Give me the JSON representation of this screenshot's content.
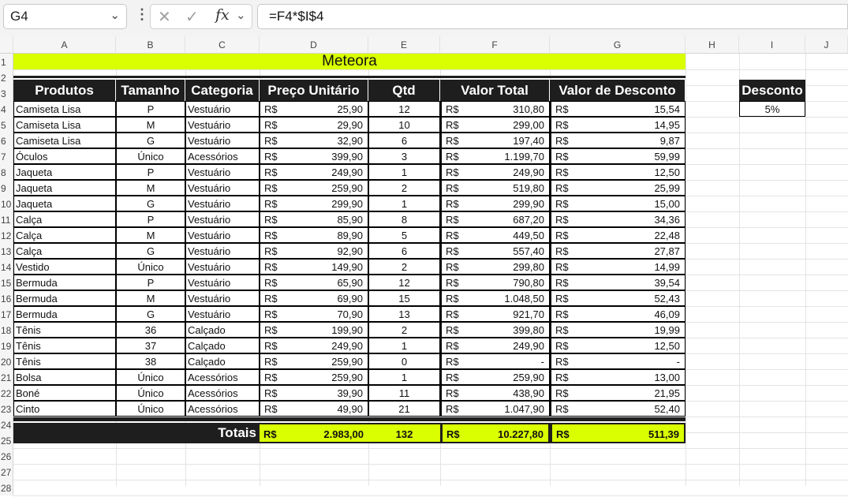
{
  "formula_bar": {
    "name_box": "G4",
    "formula": "=F4*$I$4",
    "icons": [
      "cancel-icon",
      "check-icon",
      "function-icon"
    ]
  },
  "columns": [
    "A",
    "B",
    "C",
    "D",
    "E",
    "F",
    "G",
    "H",
    "I",
    "J"
  ],
  "rows": [
    "1",
    "2",
    "3",
    "4",
    "5",
    "6",
    "7",
    "8",
    "9",
    "10",
    "11",
    "12",
    "13",
    "14",
    "15",
    "16",
    "17",
    "18",
    "19",
    "20",
    "21",
    "22",
    "23",
    "24",
    "25",
    "26",
    "27",
    "28"
  ],
  "sheet": {
    "title": "Meteora",
    "headers": [
      "Produtos",
      "Tamanho",
      "Categoria",
      "Preço Unitário",
      "Qtd",
      "Valor Total",
      "Valor de Desconto"
    ],
    "currency": "R$",
    "rows": [
      {
        "produto": "Camiseta Lisa",
        "tamanho": "P",
        "categoria": "Vestuário",
        "preco": "25,90",
        "qtd": "12",
        "total": "310,80",
        "desconto": "15,54"
      },
      {
        "produto": "Camiseta Lisa",
        "tamanho": "M",
        "categoria": "Vestuário",
        "preco": "29,90",
        "qtd": "10",
        "total": "299,00",
        "desconto": "14,95"
      },
      {
        "produto": "Camiseta Lisa",
        "tamanho": "G",
        "categoria": "Vestuário",
        "preco": "32,90",
        "qtd": "6",
        "total": "197,40",
        "desconto": "9,87"
      },
      {
        "produto": "Óculos",
        "tamanho": "Único",
        "categoria": "Acessórios",
        "preco": "399,90",
        "qtd": "3",
        "total": "1.199,70",
        "desconto": "59,99"
      },
      {
        "produto": "Jaqueta",
        "tamanho": "P",
        "categoria": "Vestuário",
        "preco": "249,90",
        "qtd": "1",
        "total": "249,90",
        "desconto": "12,50"
      },
      {
        "produto": "Jaqueta",
        "tamanho": "M",
        "categoria": "Vestuário",
        "preco": "259,90",
        "qtd": "2",
        "total": "519,80",
        "desconto": "25,99"
      },
      {
        "produto": "Jaqueta",
        "tamanho": "G",
        "categoria": "Vestuário",
        "preco": "299,90",
        "qtd": "1",
        "total": "299,90",
        "desconto": "15,00"
      },
      {
        "produto": "Calça",
        "tamanho": "P",
        "categoria": "Vestuário",
        "preco": "85,90",
        "qtd": "8",
        "total": "687,20",
        "desconto": "34,36"
      },
      {
        "produto": "Calça",
        "tamanho": "M",
        "categoria": "Vestuário",
        "preco": "89,90",
        "qtd": "5",
        "total": "449,50",
        "desconto": "22,48"
      },
      {
        "produto": "Calça",
        "tamanho": "G",
        "categoria": "Vestuário",
        "preco": "92,90",
        "qtd": "6",
        "total": "557,40",
        "desconto": "27,87"
      },
      {
        "produto": "Vestido",
        "tamanho": "Único",
        "categoria": "Vestuário",
        "preco": "149,90",
        "qtd": "2",
        "total": "299,80",
        "desconto": "14,99"
      },
      {
        "produto": "Bermuda",
        "tamanho": "P",
        "categoria": "Vestuário",
        "preco": "65,90",
        "qtd": "12",
        "total": "790,80",
        "desconto": "39,54"
      },
      {
        "produto": "Bermuda",
        "tamanho": "M",
        "categoria": "Vestuário",
        "preco": "69,90",
        "qtd": "15",
        "total": "1.048,50",
        "desconto": "52,43"
      },
      {
        "produto": "Bermuda",
        "tamanho": "G",
        "categoria": "Vestuário",
        "preco": "70,90",
        "qtd": "13",
        "total": "921,70",
        "desconto": "46,09"
      },
      {
        "produto": "Tênis",
        "tamanho": "36",
        "categoria": "Calçado",
        "preco": "199,90",
        "qtd": "2",
        "total": "399,80",
        "desconto": "19,99"
      },
      {
        "produto": "Tênis",
        "tamanho": "37",
        "categoria": "Calçado",
        "preco": "249,90",
        "qtd": "1",
        "total": "249,90",
        "desconto": "12,50"
      },
      {
        "produto": "Tênis",
        "tamanho": "38",
        "categoria": "Calçado",
        "preco": "259,90",
        "qtd": "0",
        "total": "-",
        "desconto": "-"
      },
      {
        "produto": "Bolsa",
        "tamanho": "Único",
        "categoria": "Acessórios",
        "preco": "259,90",
        "qtd": "1",
        "total": "259,90",
        "desconto": "13,00"
      },
      {
        "produto": "Boné",
        "tamanho": "Único",
        "categoria": "Acessórios",
        "preco": "39,90",
        "qtd": "11",
        "total": "438,90",
        "desconto": "21,95"
      },
      {
        "produto": "Cinto",
        "tamanho": "Único",
        "categoria": "Acessórios",
        "preco": "49,90",
        "qtd": "21",
        "total": "1.047,90",
        "desconto": "52,40"
      }
    ],
    "totals": {
      "label": "Totais",
      "preco": "2.983,00",
      "qtd": "132",
      "total": "10.227,80",
      "desconto": "511,39"
    },
    "discount": {
      "label": "Desconto",
      "value": "5%"
    }
  },
  "colors": {
    "accent": "#d9ff00",
    "header": "#1e1e1e"
  }
}
